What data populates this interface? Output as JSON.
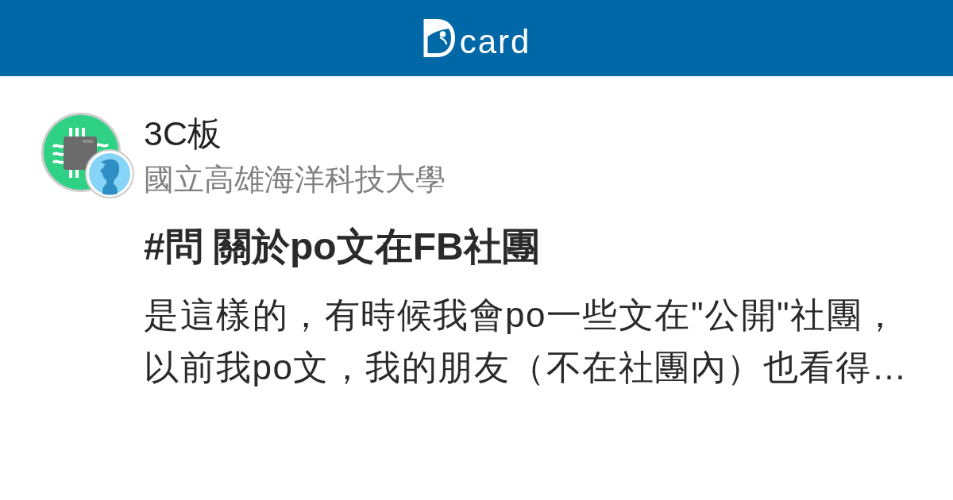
{
  "header": {
    "logo_text": "card"
  },
  "board": {
    "name": "3C板",
    "school": "國立高雄海洋科技大學"
  },
  "post": {
    "title": "#問 關於po文在FB社團",
    "excerpt": "是這樣的，有時候我會po一些文在\"公開\"社團，以前我po文，我的朋友（不在社團內）也看得…"
  }
}
